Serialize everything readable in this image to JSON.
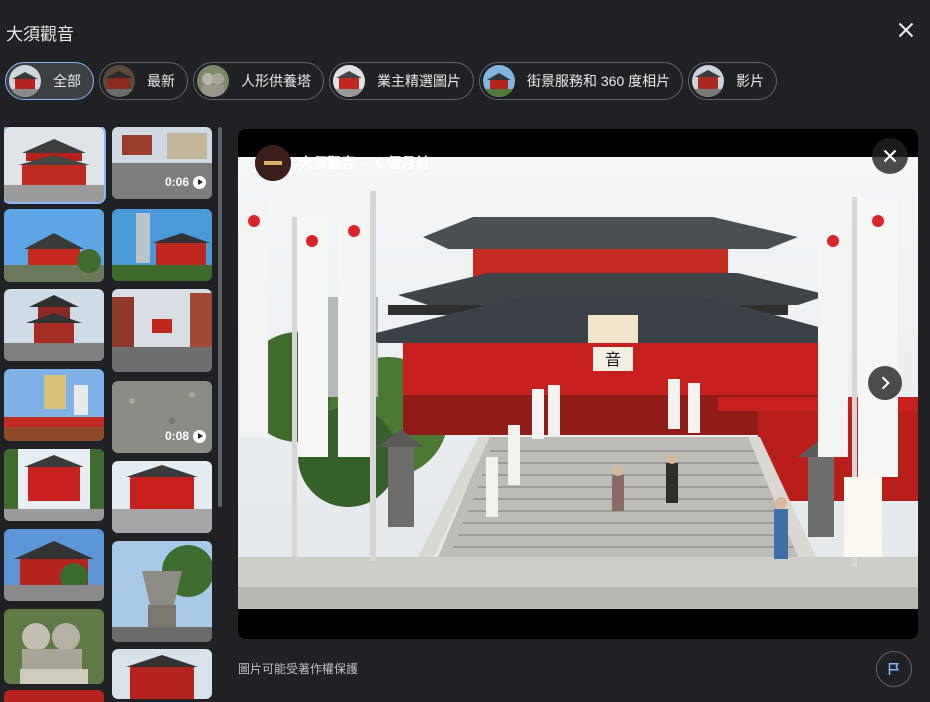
{
  "header": {
    "title": "大須觀音"
  },
  "chips": [
    {
      "label": "全部",
      "active": true
    },
    {
      "label": "最新",
      "active": false
    },
    {
      "label": "人形供養塔",
      "active": false
    },
    {
      "label": "業主精選圖片",
      "active": false
    },
    {
      "label": "街景服務和 360 度相片",
      "active": false
    },
    {
      "label": "影片",
      "active": false
    }
  ],
  "thumbnails": {
    "video_1_duration": "0:06",
    "video_2_duration": "0:08"
  },
  "viewer": {
    "author": "大須觀音",
    "separator": "·",
    "time_ago": "6 個月前",
    "temple_plaque": "音"
  },
  "footer": {
    "copyright_notice": "圖片可能受著作權保護"
  },
  "colors": {
    "background": "#202124",
    "accent": "#8ab4f8",
    "temple_red": "#c8201e"
  }
}
